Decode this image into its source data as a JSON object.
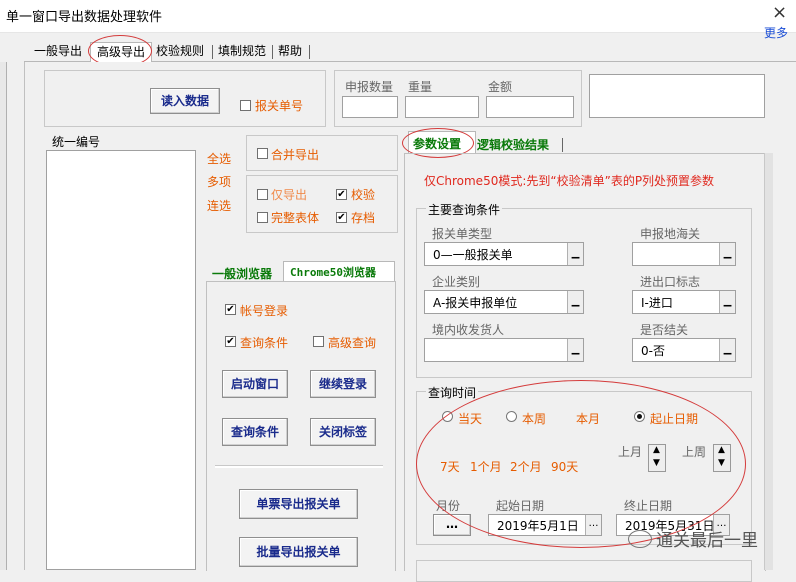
{
  "window": {
    "title": "单一窗口导出数据处理软件",
    "close": "×",
    "more": "更多"
  },
  "tabs": [
    "一般导出",
    "高级导出",
    "校验规则",
    "填制规范",
    "帮助"
  ],
  "top": {
    "read_btn": "读入数据",
    "bgd_no": "报关单号",
    "col_labels": [
      "申报数量",
      "重量",
      "金额"
    ]
  },
  "left": {
    "list_header": "统一编号",
    "links": [
      "全选",
      "多项",
      "连选"
    ]
  },
  "options": {
    "merge": "合并导出",
    "export_only": "仅导出",
    "verify": "校验",
    "full_table": "完整表体",
    "archive": "存档"
  },
  "browser_tabs": [
    "一般浏览器",
    "Chrome50浏览器"
  ],
  "browser": {
    "account_login": "帐号登录",
    "query_cond": "查询条件",
    "adv_query": "高级查询",
    "btn_start": "启动窗口",
    "btn_continue": "继续登录",
    "btn_query": "查询条件",
    "btn_close": "关闭标签",
    "btn_single": "单票导出报关单",
    "btn_batch": "批量导出报关单"
  },
  "param_tabs": [
    "参数设置",
    "逻辑校验结果"
  ],
  "params": {
    "notice": "仅Chrome50模式:先到“校验清单”表的P列处预置参数",
    "main_group": "主要查询条件",
    "f1_label": "报关单类型",
    "f1_value": "0—一般报关单",
    "f2_label": "申报地海关",
    "f2_value": "",
    "f3_label": "企业类别",
    "f3_value": "A-报关申报单位",
    "f4_label": "进出口标志",
    "f4_value": "I-进口",
    "f5_label": "境内收发货人",
    "f5_value": "",
    "f6_label": "是否结关",
    "f6_value": "0-否",
    "time_group": "查询时间",
    "radios": [
      "当天",
      "本周",
      "本月",
      "起止日期"
    ],
    "quick": [
      "7天",
      "1个月",
      "2个月",
      "90天"
    ],
    "prev_month": "上月",
    "prev_week": "上周",
    "month_label": "月份",
    "start_label": "起始日期",
    "start_value": "2019年5月1日",
    "end_label": "终止日期",
    "end_value": "2019年5月31日"
  },
  "watermark": "通关最后一里",
  "colors": {
    "annotation": "#d43b3b",
    "accent_orange": "#e65c00",
    "tab_green": "#0a7a0a"
  }
}
